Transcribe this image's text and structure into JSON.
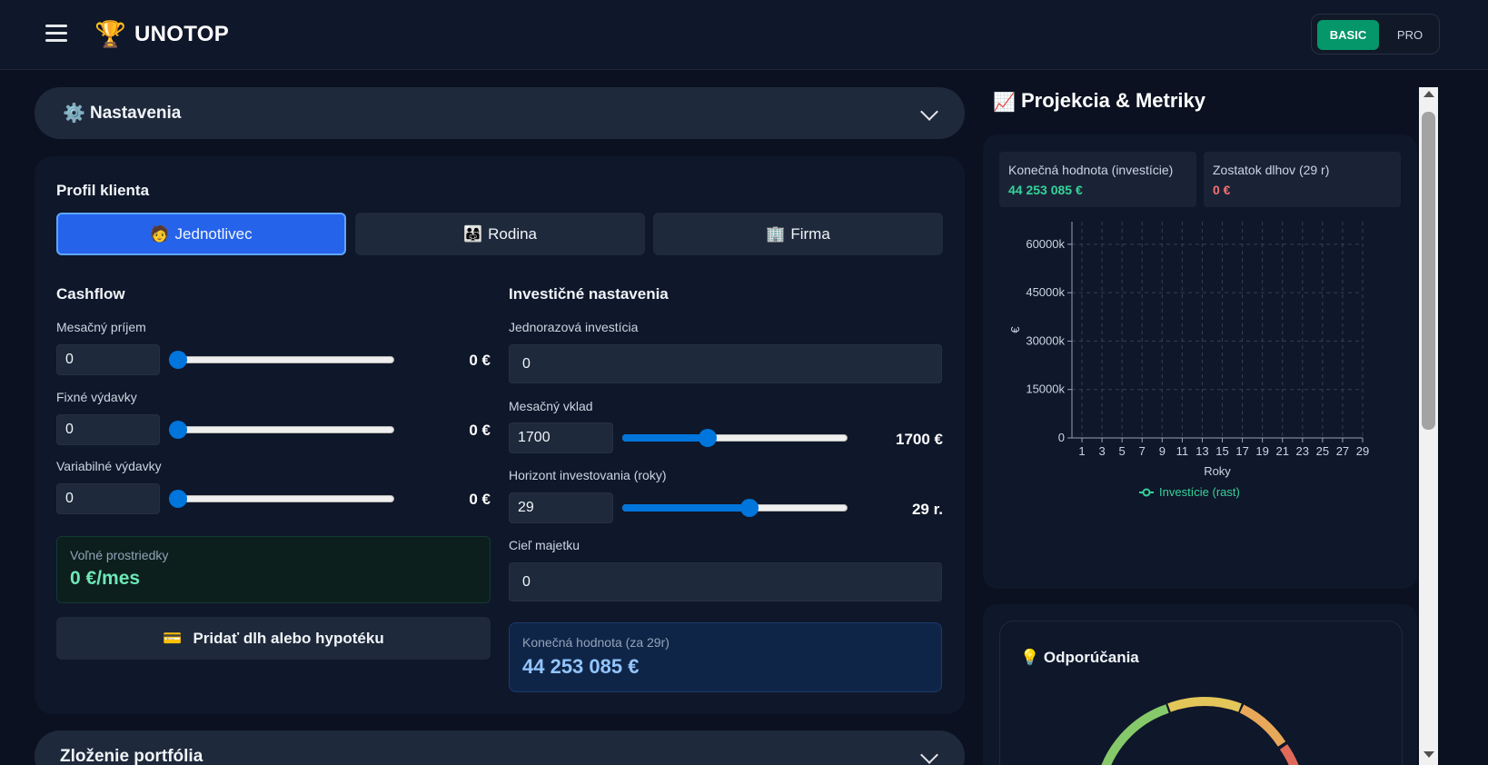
{
  "header": {
    "brand_icon": "🏆",
    "brand": "UNOTOP",
    "mode_basic": "BASIC",
    "mode_pro": "PRO"
  },
  "settings_bar": {
    "icon": "⚙️",
    "title": "Nastavenia"
  },
  "portfolio_bar": {
    "title": "Zloženie portfólia"
  },
  "profile": {
    "title": "Profil klienta",
    "options": [
      {
        "icon": "🧑",
        "label": "Jednotlivec",
        "active": true
      },
      {
        "icon": "👨‍👩‍👧",
        "label": "Rodina",
        "active": false
      },
      {
        "icon": "🏢",
        "label": "Firma",
        "active": false
      }
    ]
  },
  "cashflow": {
    "title": "Cashflow",
    "income": {
      "label": "Mesačný príjem",
      "value": "0",
      "display": "0 €",
      "level": 0
    },
    "fixed": {
      "label": "Fixné výdavky",
      "value": "0",
      "display": "0 €",
      "level": 0
    },
    "variable": {
      "label": "Variabilné výdavky",
      "value": "0",
      "display": "0 €",
      "level": 0
    },
    "free": {
      "label": "Voľné prostriedky",
      "value": "0 €/mes"
    },
    "debt_button": {
      "icon": "💳",
      "label": "Pridať dlh alebo hypotéku"
    }
  },
  "investment": {
    "title": "Investičné nastavenia",
    "lump": {
      "label": "Jednorazová investícia",
      "value": "0"
    },
    "monthly": {
      "label": "Mesačný vklad",
      "value": "1700",
      "display": "1700 €",
      "level": 0.37
    },
    "horizon": {
      "label": "Horizont investovania (roky)",
      "value": "29",
      "display": "29 r.",
      "level": 0.57
    },
    "goal": {
      "label": "Cieľ majetku",
      "value": "0"
    },
    "final": {
      "label": "Konečná hodnota (za 29r)",
      "value": "44 253 085 €"
    }
  },
  "right": {
    "title_icon": "📈",
    "title": "Projekcia & Metriky",
    "metric1": {
      "label": "Konečná hodnota (investície)",
      "value": "44 253 085 €",
      "color": "#34d399"
    },
    "metric2": {
      "label": "Zostatok dlhov (29 r)",
      "value": "0 €",
      "color": "#f87171"
    },
    "recommendations": {
      "icon": "💡",
      "title": "Odporúčania"
    }
  },
  "chart_data": {
    "type": "line",
    "xlabel": "Roky",
    "ylabel": "€",
    "x": [
      1,
      3,
      5,
      7,
      9,
      11,
      13,
      15,
      17,
      19,
      21,
      23,
      25,
      27,
      29
    ],
    "y_ticks": [
      "0",
      "15000k",
      "30000k",
      "45000k",
      "60000k"
    ],
    "ylim": [
      0,
      67000000
    ],
    "xlim": [
      0,
      29
    ],
    "grid": true,
    "series": [
      {
        "name": "Investície (rast)",
        "values": [],
        "color": "#34d399"
      }
    ]
  }
}
